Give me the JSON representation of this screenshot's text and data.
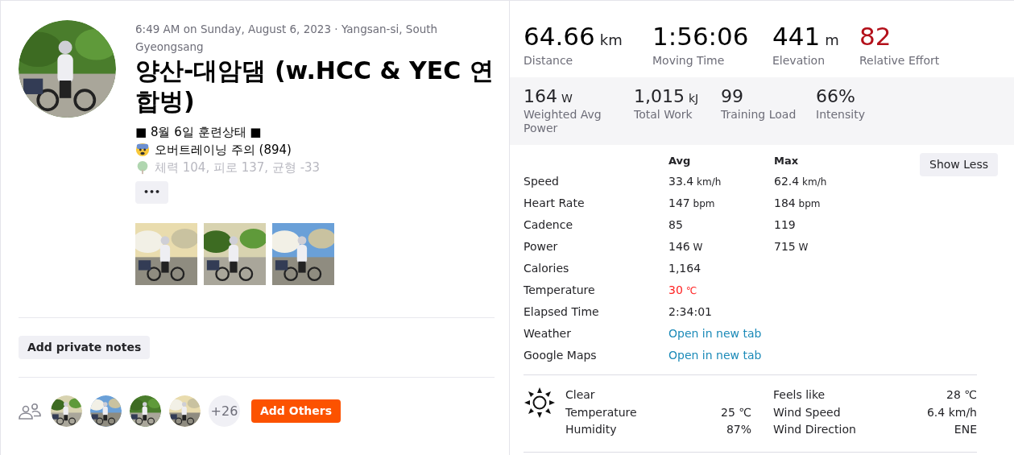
{
  "activity": {
    "meta": "6:49 AM on Sunday, August 6, 2023 · Yangsan-si, South Gyeongsang",
    "title": "양산-대암댐 (w.HCC & YEC 연합벙)",
    "description": [
      {
        "kind": "text",
        "text": "■ 8월 6일 훈련상태 ■"
      },
      {
        "kind": "scared",
        "text": "오버트레이닝 주의 (894)"
      },
      {
        "kind": "tree",
        "text": "체력 104, 피로 137, 균형 -33"
      }
    ],
    "more_button": "•••",
    "notes_button": "Add private notes",
    "participants": {
      "more": "+26",
      "add_button": "Add Others"
    }
  },
  "primary_stats": [
    {
      "value": "64.66",
      "unit": "km",
      "label": "Distance",
      "alert": false
    },
    {
      "value": "1:56:06",
      "label": "Moving Time",
      "alert": false
    },
    {
      "value": "441",
      "unit": "m",
      "label": "Elevation",
      "alert": false
    },
    {
      "value": "82",
      "label": "Relative Effort",
      "alert": true
    }
  ],
  "secondary_stats": [
    {
      "value": "164",
      "unit": "W",
      "label": "Weighted Avg Power"
    },
    {
      "value": "1,015",
      "unit": "kJ",
      "label": "Total Work"
    },
    {
      "value": "99",
      "label": "Training Load"
    },
    {
      "value": "66%",
      "label": "Intensity"
    }
  ],
  "details": {
    "columns": [
      "Avg",
      "Max"
    ],
    "toggle_button": "Show Less",
    "rows": [
      {
        "label": "Speed",
        "kind": "value",
        "avg": "33.4",
        "avg_unit": "km/h",
        "max": "62.4",
        "max_unit": "km/h",
        "alert": false
      },
      {
        "label": "Heart Rate",
        "kind": "value",
        "avg": "147",
        "avg_unit": "bpm",
        "max": "184",
        "max_unit": "bpm",
        "alert": false
      },
      {
        "label": "Cadence",
        "kind": "value",
        "avg": "85",
        "max": "119",
        "alert": false
      },
      {
        "label": "Power",
        "kind": "value",
        "avg": "146",
        "avg_unit": "W",
        "max": "715",
        "max_unit": "W",
        "alert": false
      },
      {
        "label": "Calories",
        "kind": "value",
        "avg": "1,164",
        "alert": false
      },
      {
        "label": "Temperature",
        "kind": "value",
        "avg": "30",
        "avg_unit": "℃",
        "alert": true
      },
      {
        "label": "Elapsed Time",
        "kind": "value",
        "avg": "2:34:01",
        "alert": false
      },
      {
        "label": "Weather",
        "kind": "link",
        "avg": "Open in new tab"
      },
      {
        "label": "Google Maps",
        "kind": "link",
        "avg": "Open in new tab"
      }
    ]
  },
  "weather": {
    "condition": "Clear",
    "left": [
      {
        "label": "Temperature",
        "value": "25 ℃"
      },
      {
        "label": "Humidity",
        "value": "87%"
      }
    ],
    "right": [
      {
        "label": "Feels like",
        "value": "28 ℃"
      },
      {
        "label": "Wind Speed",
        "value": "6.4 km/h"
      },
      {
        "label": "Wind Direction",
        "value": "ENE"
      }
    ]
  }
}
